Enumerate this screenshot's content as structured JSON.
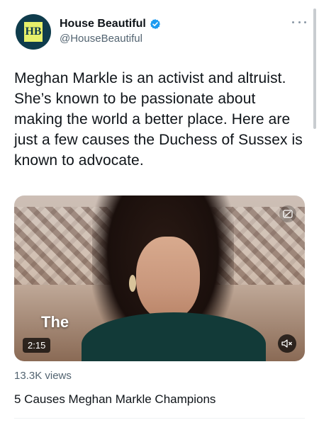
{
  "account": {
    "display_name": "House Beautiful",
    "handle": "@HouseBeautiful",
    "avatar_text": "HB",
    "verified": true
  },
  "tweet": {
    "text": "Meghan Markle is an activist and altruist. She’s known to be passionate about making the world a better place. Here are just a few causes the Duchess of Sussex is known to advocate."
  },
  "video": {
    "overlay_text": "The",
    "duration": "2:15",
    "views": "13.3K views",
    "title": "5 Causes Meghan Markle Champions"
  },
  "icons": {
    "verified": "verified-badge-icon",
    "more": "more-options-icon",
    "captions": "captions-icon",
    "mute": "mute-icon"
  },
  "colors": {
    "verified_blue": "#1d9bf0",
    "avatar_bg": "#0f3c4c",
    "avatar_box": "#e7f06a",
    "secondary_text": "#536471"
  }
}
